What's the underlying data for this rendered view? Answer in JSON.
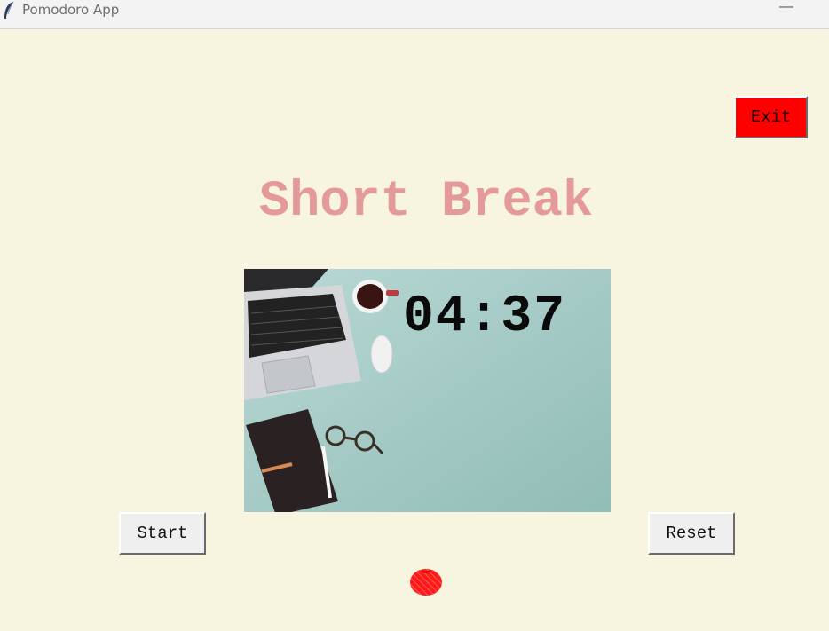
{
  "window": {
    "title": "Pomodoro App",
    "minimize_label": "—"
  },
  "header": {
    "heading": "Short Break"
  },
  "timer": {
    "time": "04:37"
  },
  "controls": {
    "exit_label": "Exit",
    "start_label": "Start",
    "reset_label": "Reset"
  },
  "checkmarks": {
    "completed_sessions": 1,
    "icon": "tomato-icon"
  },
  "colors": {
    "background": "#f7f5df",
    "heading": "#e59a9a",
    "exit_button": "#ff0000",
    "button": "#efefef",
    "tomato": "#ff1a1a"
  }
}
